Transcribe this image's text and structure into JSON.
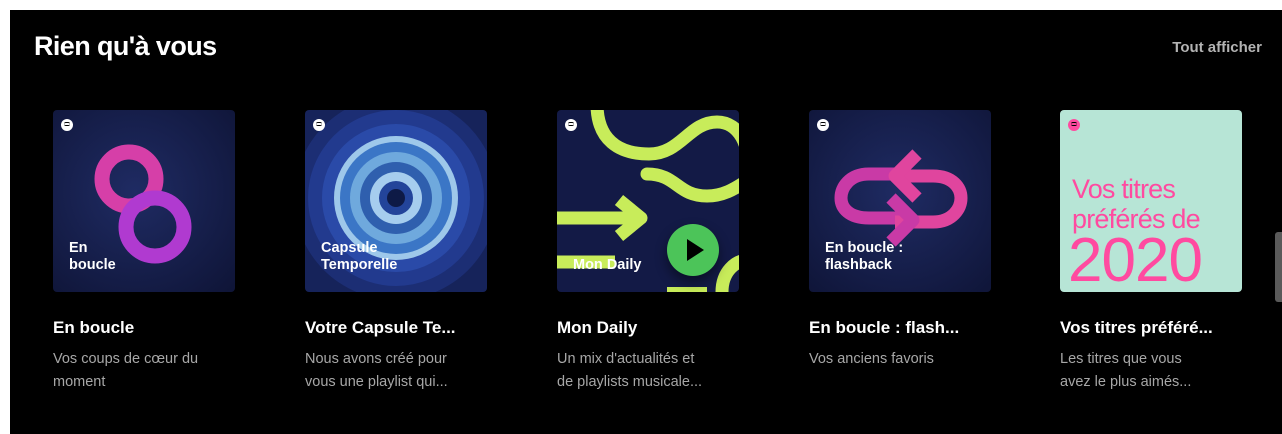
{
  "shelf": {
    "title": "Rien qu'à vous",
    "see_all": "Tout afficher"
  },
  "cards": [
    {
      "cover_label": "En\nboucle",
      "title": "En boucle",
      "description": "Vos coups de cœur du\nmoment"
    },
    {
      "cover_label": "Capsule\nTemporelle",
      "title": "Votre Capsule Te...",
      "description": "Nous avons créé pour\nvous une playlist qui..."
    },
    {
      "cover_label": "Mon Daily",
      "title": "Mon Daily",
      "description": "Un mix d'actualités et\nde playlists musicale..."
    },
    {
      "cover_label": "En boucle :\nflashback",
      "title": "En boucle : flash...",
      "description": "Vos anciens favoris"
    },
    {
      "cover_text": "Vos titres\npréférés de",
      "cover_year": "2020",
      "title": "Vos titres préféré...",
      "description": "Les titres que vous\navez le plus aimés..."
    }
  ],
  "colors": {
    "background": "#000000",
    "cover_navy": "#141c4a",
    "pink": "#e540a8",
    "lime": "#c8ec5a",
    "play_green": "#1ed760",
    "mint": "#b7e5d6",
    "hot_pink": "#ff4aa0"
  },
  "icons": [
    "spotify-icon",
    "play-icon"
  ]
}
